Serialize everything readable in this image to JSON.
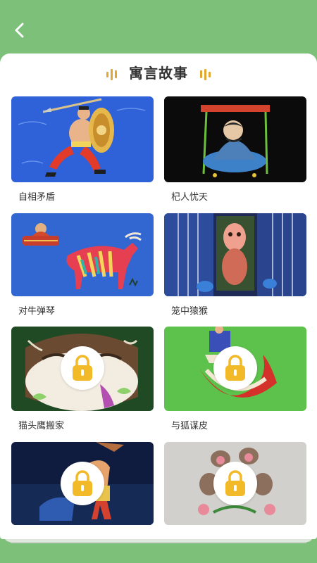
{
  "header": {
    "back_icon": "chevron-left-icon"
  },
  "section": {
    "title": "寓言故事"
  },
  "colors": {
    "background": "#7cc07a",
    "accent": "#e0a733",
    "lock": "#f2b928"
  },
  "stories": [
    {
      "title": "自相矛盾",
      "locked": false
    },
    {
      "title": "杞人忧天",
      "locked": false
    },
    {
      "title": "对牛弹琴",
      "locked": false
    },
    {
      "title": "笼中猿猴",
      "locked": false
    },
    {
      "title": "猫头鹰搬家",
      "locked": true
    },
    {
      "title": "与狐谋皮",
      "locked": true
    },
    {
      "title": "",
      "locked": true
    },
    {
      "title": "",
      "locked": true
    }
  ]
}
